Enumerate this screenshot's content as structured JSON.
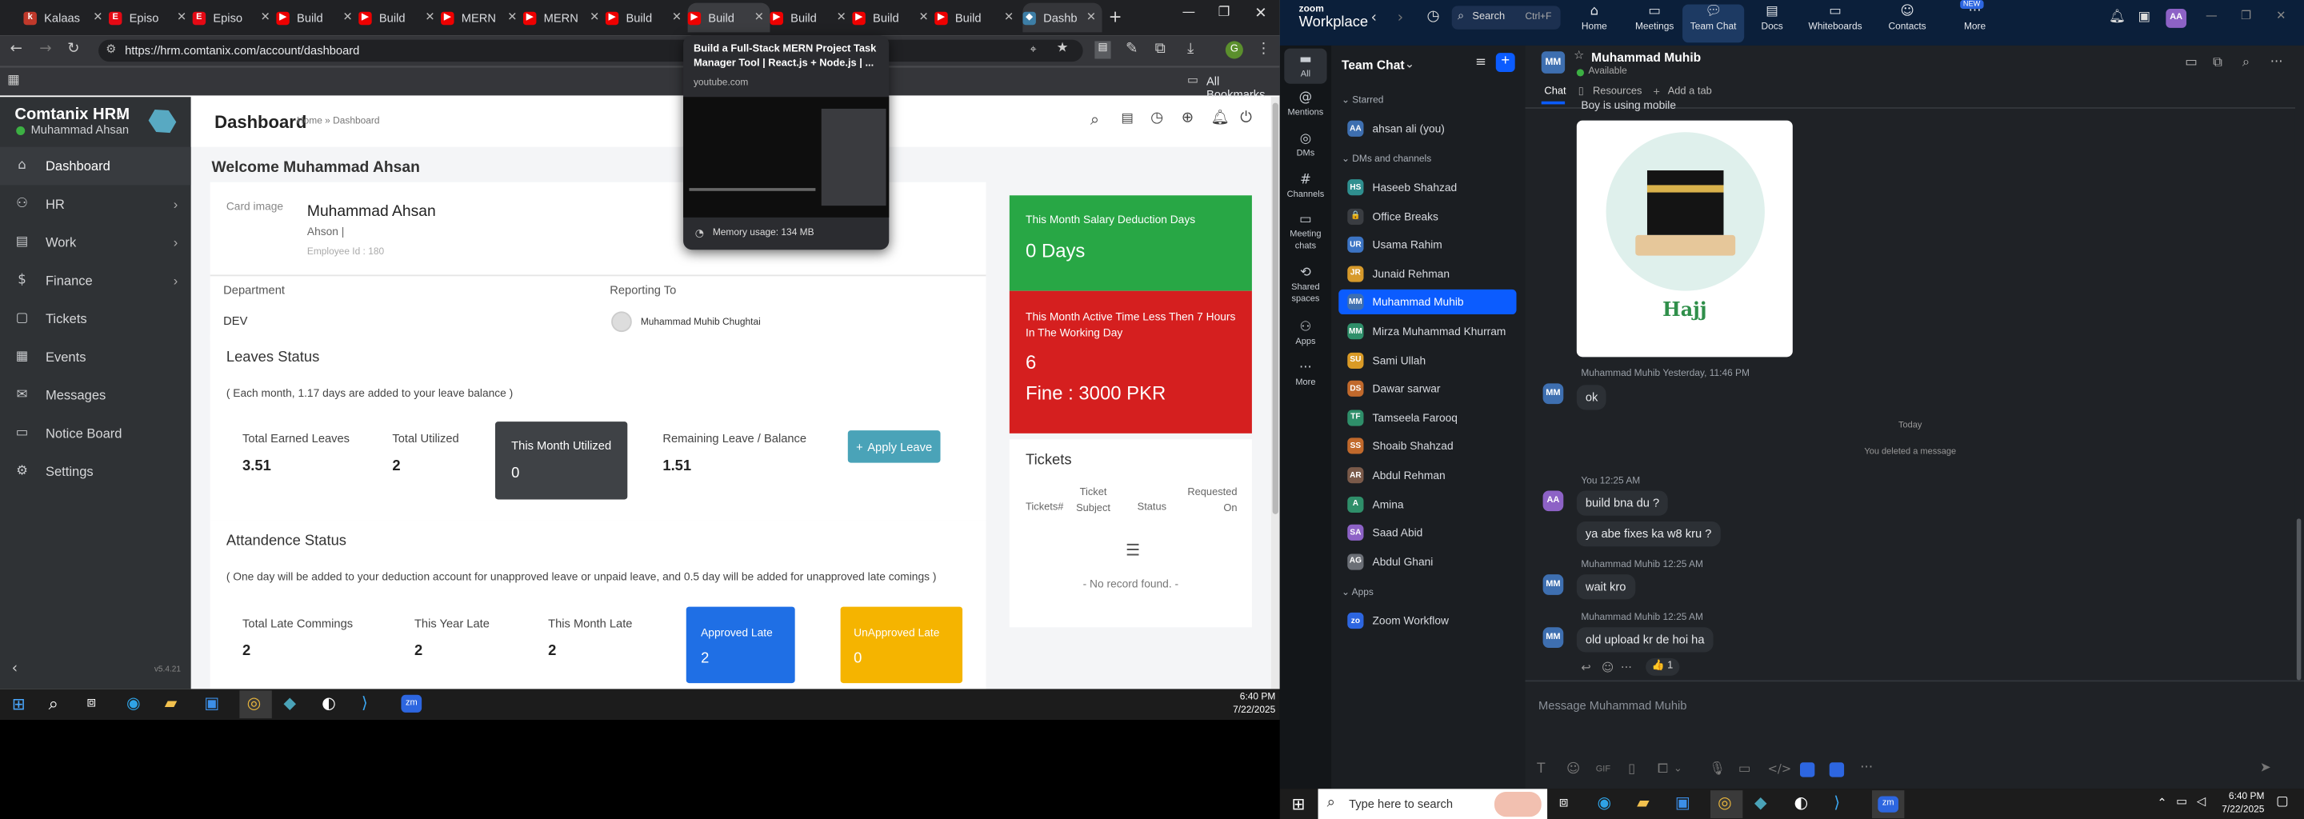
{
  "browser": {
    "tabs": [
      "Kalaas",
      "Episo",
      "Episo",
      "Build",
      "Build",
      "MERN",
      "MERN",
      "Build",
      "Build",
      "Build",
      "Build",
      "Build",
      "Dashb"
    ],
    "active_tab": 12,
    "url": "https://hrm.comtanix.com/account/dashboard",
    "all_bookmarks": "All Bookmarks",
    "hover_card": {
      "title": "Build a Full-Stack MERN Project Task Manager Tool | React.js + Node.js | ...",
      "domain": "youtube.com",
      "memory": "Memory usage: 134 MB"
    }
  },
  "hrm": {
    "brand": "Comtanix HRM",
    "user": "Muhammad Ahsan",
    "version": "v5.4.21",
    "nav": [
      {
        "label": "Dashboard",
        "icon": "home-icon",
        "has_sub": false
      },
      {
        "label": "HR",
        "icon": "users-icon",
        "has_sub": true
      },
      {
        "label": "Work",
        "icon": "briefcase-icon",
        "has_sub": true
      },
      {
        "label": "Finance",
        "icon": "dollar-icon",
        "has_sub": true
      },
      {
        "label": "Tickets",
        "icon": "ticket-icon",
        "has_sub": false
      },
      {
        "label": "Events",
        "icon": "calendar-icon",
        "has_sub": false
      },
      {
        "label": "Messages",
        "icon": "message-icon",
        "has_sub": false
      },
      {
        "label": "Notice Board",
        "icon": "notice-icon",
        "has_sub": false
      },
      {
        "label": "Settings",
        "icon": "settings-icon",
        "has_sub": false
      }
    ],
    "page_title": "Dashboard",
    "breadcrumb": "Home » Dashboard",
    "welcome": "Welcome Muhammad Ahsan",
    "profile": {
      "image_alt": "Card image",
      "name": "Muhammad Ahsan",
      "subtitle": "Ahson |",
      "employee_id": "Employee Id : 180",
      "department_label": "Department",
      "department": "DEV",
      "reporting_label": "Reporting To",
      "reporting_to": "Muhammad Muhib Chughtai"
    },
    "leaves": {
      "title": "Leaves Status",
      "note": "( Each month, 1.17 days are added to your leave balance )",
      "earned_label": "Total Earned Leaves",
      "earned": "3.51",
      "utilized_label": "Total Utilized",
      "utilized": "2",
      "month_label": "This Month Utilized",
      "month": "0",
      "remaining_label": "Remaining Leave / Balance",
      "remaining": "1.51",
      "apply_button": "Apply Leave"
    },
    "attendance": {
      "title": "Attandence Status",
      "note": "( One day will be added to your deduction account for unapproved leave or unpaid leave, and 0.5 day will be added for unapproved late comings )",
      "late_label": "Total Late Commings",
      "late": "2",
      "year_label": "This Year Late",
      "year": "2",
      "month_label": "This Month Late",
      "month": "2",
      "approved_label": "Approved Late",
      "approved": "2",
      "unapproved_label": "UnApproved Late",
      "unapproved": "0"
    },
    "salary": {
      "title": "This Month Salary Deduction Days",
      "value": "0 Days"
    },
    "active_time": {
      "title": "This Month Active Time Less Then 7 Hours In The Working Day",
      "value": "6",
      "fine": "Fine : 3000 PKR"
    },
    "tickets": {
      "title": "Tickets",
      "columns": [
        "Tickets#",
        "Ticket Subject",
        "Status",
        "Requested On"
      ],
      "empty": "- No record found. -"
    }
  },
  "taskbar_left": {
    "time": "6:40 PM",
    "date": "7/22/2025"
  },
  "taskbar_right": {
    "search_placeholder": "Type here to search",
    "time": "6:40 PM",
    "date": "7/22/2025"
  },
  "zoom": {
    "brand_top": "zoom",
    "brand": "Workplace",
    "search": "Search",
    "shortcut": "Ctrl+F",
    "nav": [
      "Home",
      "Meetings",
      "Team Chat",
      "Docs",
      "Whiteboards",
      "Contacts",
      "More"
    ],
    "new_badge": "NEW",
    "rail": [
      "All",
      "Mentions",
      "DMs",
      "Channels",
      "Meeting chats",
      "Shared spaces",
      "Apps",
      "More"
    ],
    "panel_title": "Team Chat",
    "starred_label": "Starred",
    "starred": [
      {
        "name": "ahsan ali (you)",
        "initials": "AA",
        "color": "#3e6fb0"
      }
    ],
    "dms_label": "DMs and channels",
    "dms": [
      {
        "name": "Haseeb Shahzad",
        "initials": "HS",
        "color": "#2f8f8f"
      },
      {
        "name": "Office Breaks",
        "initials": "🔒",
        "color": "#3a3d42"
      },
      {
        "name": "Usama Rahim",
        "initials": "UR",
        "color": "#3c74c4"
      },
      {
        "name": "Junaid Rehman",
        "initials": "JR",
        "color": "#d79a2b"
      },
      {
        "name": "Muhammad Muhib",
        "initials": "MM",
        "color": "#3e6fb0"
      },
      {
        "name": "Mirza Muhammad Khurram",
        "initials": "MM",
        "color": "#2f8f6a"
      },
      {
        "name": "Sami Ullah",
        "initials": "SU",
        "color": "#d99a26"
      },
      {
        "name": "Dawar sarwar",
        "initials": "DS",
        "color": "#c1692c"
      },
      {
        "name": "Tamseela Farooq",
        "initials": "TF",
        "color": "#2f8f6a"
      },
      {
        "name": "Shoaib Shahzad",
        "initials": "SS",
        "color": "#c1692c"
      },
      {
        "name": "Abdul Rehman",
        "initials": "AR",
        "color": "#7a5a4a"
      },
      {
        "name": "Amina",
        "initials": "A",
        "color": "#2f8f6a"
      },
      {
        "name": "Saad Abid",
        "initials": "SA",
        "color": "#8d62c6"
      },
      {
        "name": "Abdul Ghani",
        "initials": "AG",
        "color": "#6b6f76"
      }
    ],
    "active_dm": 4,
    "apps_label": "Apps",
    "apps": [
      {
        "name": "Zoom Workflow",
        "initials": "zoom",
        "color": "#2d66e0"
      }
    ],
    "chat": {
      "name": "Muhammad Muhib",
      "status": "Available",
      "tabs": [
        "Chat",
        "Resources",
        "Add a tab"
      ],
      "caption_top": "Boy is using mobile",
      "image_caption": "Hajj",
      "messages": [
        {
          "sender": "Muhammad Muhib",
          "time": "Yesterday, 11:46 PM",
          "text": "ok",
          "initials": "MM"
        }
      ],
      "today": "Today",
      "deleted": "You deleted a message",
      "mine_header": "You 12:25 AM",
      "mine": [
        "build bna du  ?",
        "ya abe fixes ka w8 kru ?"
      ],
      "reply1_header": "Muhammad Muhib 12:25 AM",
      "reply1": "wait kro",
      "reply2_header": "Muhammad Muhib 12:25 AM",
      "reply2": "old upload kr de hoi ha",
      "reaction": "👍 1",
      "composer_placeholder": "Message Muhammad Muhib"
    }
  },
  "colors": {
    "accent_blue": "#0b5cff",
    "salary_green": "#28a745",
    "active_red": "#d51f1f",
    "approved_blue": "#1f6fe5",
    "unapproved_yellow": "#f5b400",
    "apply_teal": "#4aa3b8"
  }
}
